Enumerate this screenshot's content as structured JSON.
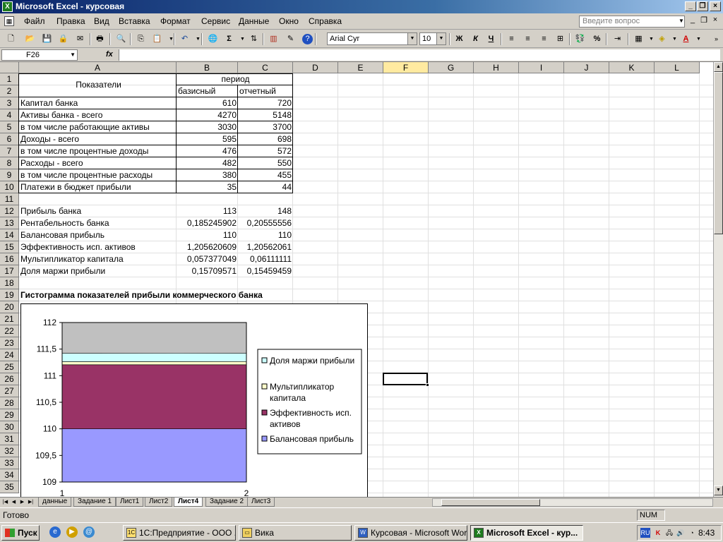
{
  "window": {
    "title": "Microsoft Excel - курсовая",
    "icon_text": "X"
  },
  "menu": {
    "items": [
      "Файл",
      "Правка",
      "Вид",
      "Вставка",
      "Формат",
      "Сервис",
      "Данные",
      "Окно",
      "Справка"
    ],
    "ask_placeholder": "Введите вопрос"
  },
  "toolbar": {
    "font_name": "Arial Cyr",
    "font_size": "10",
    "bold": "Ж",
    "italic": "К",
    "underline": "Ч",
    "percent": "%",
    "sum": "Σ"
  },
  "formula_bar": {
    "name_box": "F26",
    "fx": "fx",
    "formula": ""
  },
  "columns": [
    "A",
    "B",
    "C",
    "D",
    "E",
    "F",
    "G",
    "H",
    "I",
    "J",
    "K",
    "L"
  ],
  "selected_column": "F",
  "rows": [
    "1",
    "2",
    "3",
    "4",
    "5",
    "6",
    "7",
    "8",
    "9",
    "10",
    "11",
    "12",
    "13",
    "14",
    "15",
    "16",
    "17",
    "18",
    "19",
    "20",
    "21",
    "22",
    "23",
    "24",
    "25",
    "26",
    "27",
    "28",
    "29",
    "30",
    "31",
    "32",
    "33",
    "34",
    "35"
  ],
  "table": {
    "header_a": "Показатели",
    "header_period": "период",
    "header_b": "базисный",
    "header_c": "отчетный",
    "rows": [
      {
        "label": "Капитал банка",
        "b": "610",
        "c": "720"
      },
      {
        "label": "Активы банка - всего",
        "b": "4270",
        "c": "5148"
      },
      {
        "label": "в том числе работающие активы",
        "b": "3030",
        "c": "3700"
      },
      {
        "label": "Доходы - всего",
        "b": "595",
        "c": "698"
      },
      {
        "label": "в том числе процентные доходы",
        "b": "476",
        "c": "572"
      },
      {
        "label": "Расходы - всего",
        "b": "482",
        "c": "550"
      },
      {
        "label": "в том числе процентные расходы",
        "b": "380",
        "c": "455"
      },
      {
        "label": "Платежи в бюджет прибыли",
        "b": "35",
        "c": "44"
      }
    ],
    "rows2": [
      {
        "label": "Прибыль банка",
        "b": "113",
        "c": "148"
      },
      {
        "label": "Рентабельность банка",
        "b": "0,185245902",
        "c": "0,20555556"
      },
      {
        "label": "Балансовая прибыль",
        "b": "110",
        "c": "110"
      },
      {
        "label": "Эффективность исп. активов",
        "b": "1,205620609",
        "c": "1,20562061"
      },
      {
        "label": "Мультипликатор капитала",
        "b": "0,057377049",
        "c": "0,06111111"
      },
      {
        "label": "Доля маржи прибыли",
        "b": "0,15709571",
        "c": "0,15459459"
      }
    ],
    "chart_caption": "Гистограмма показателей прибыли коммерческого банка"
  },
  "chart_data": {
    "type": "bar",
    "stacked": true,
    "categories": [
      "1",
      "2"
    ],
    "ylim": [
      109,
      112
    ],
    "yticks": [
      "109",
      "109,5",
      "110",
      "110,5",
      "111",
      "111,5",
      "112"
    ],
    "series": [
      {
        "name": "Балансовая прибыль",
        "values": [
          110,
          110
        ],
        "color": "#9999ff"
      },
      {
        "name": "Эффективность исп. активов",
        "values": [
          1.205620609,
          1.20562061
        ],
        "color": "#993366"
      },
      {
        "name": "Мультипликатор капитала",
        "values": [
          0.057377049,
          0.06111111
        ],
        "color": "#ffffcc"
      },
      {
        "name": "Доля маржи прибыли",
        "values": [
          0.15709571,
          0.15459459
        ],
        "color": "#ccffff"
      }
    ],
    "legend": [
      "Доля маржи прибыли",
      "Мультипликатор капитала",
      "Эффективность исп. активов",
      "Балансовая прибыль"
    ],
    "legend_position": "right",
    "plot_area_color": "#c0c0c0"
  },
  "sheet_tabs": [
    "данные",
    "Задание 1",
    "Лист1",
    "Лист2",
    "Лист4",
    "Задание 2",
    "Лист3"
  ],
  "active_sheet": "Лист4",
  "status": {
    "ready": "Готово",
    "num": "NUM"
  },
  "taskbar": {
    "start": "Пуск",
    "tasks": [
      "1С:Предприятие - ООО ...",
      "Вика",
      "Курсовая - Microsoft Word",
      "Microsoft Excel - кур..."
    ],
    "active_task": "Microsoft Excel - кур...",
    "clock": "8:43",
    "lang": "RU"
  }
}
